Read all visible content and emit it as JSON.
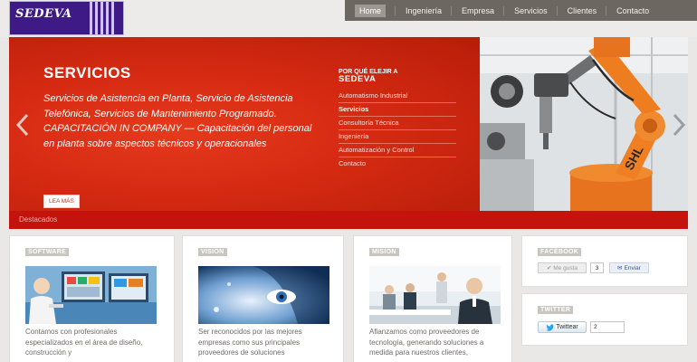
{
  "header": {
    "logo_text": "SEDEVA"
  },
  "nav": {
    "items": [
      {
        "label": "Home",
        "active": true
      },
      {
        "label": "Ingeniería"
      },
      {
        "label": "Empresa"
      },
      {
        "label": "Servicios"
      },
      {
        "label": "Clientes"
      },
      {
        "label": "Contacto"
      }
    ]
  },
  "hero": {
    "title": "SERVICIOS",
    "paragraph1": "Servicios de Asistencia en Planta, Servicio de Asistencia Telefónica, Servicios de Mantenimiento Programado.",
    "paragraph2": "CAPACITACIÓN IN COMPANY — Capacitación del personal en planta sobre aspectos técnicos y operacionales",
    "button": "LEA MÁS",
    "why_title_small": "POR QUÉ ELEJIR A",
    "why_title_big": "SEDEVA",
    "why_items": [
      "Automatismo Industrial",
      "Servicios",
      "Consultoría Técnica",
      "Ingeniería",
      "Automatización y Control",
      "Contacto"
    ],
    "active_index": 1,
    "robot_text": "SHL"
  },
  "destacados": {
    "label": "Destacados"
  },
  "cards": {
    "software": {
      "label": "SOFTWARE",
      "text": "Contamos con profesionales especializados en el área de diseño, construcción y"
    },
    "vision": {
      "label": "VISIÓN",
      "text": "Ser reconocidos por las mejores empresas como sus principales proveedores de soluciones"
    },
    "mision": {
      "label": "MISIÓN",
      "text": "Afianzamos como proveedores de tecnología, generando soluciones a medida para nuestros clientes,"
    }
  },
  "facebook": {
    "label": "FACEBOOK",
    "like": "Me gusta",
    "count": "3",
    "send": "Enviar"
  },
  "twitter": {
    "label": "TWITTER",
    "button": "Twittear",
    "count": "2"
  },
  "colors": {
    "brand_purple": "#3d1a86",
    "hero_red": "#d52a12",
    "bar_red": "#c4120c",
    "nav_gray": "#6c6761",
    "robot_orange": "#e8731e"
  }
}
